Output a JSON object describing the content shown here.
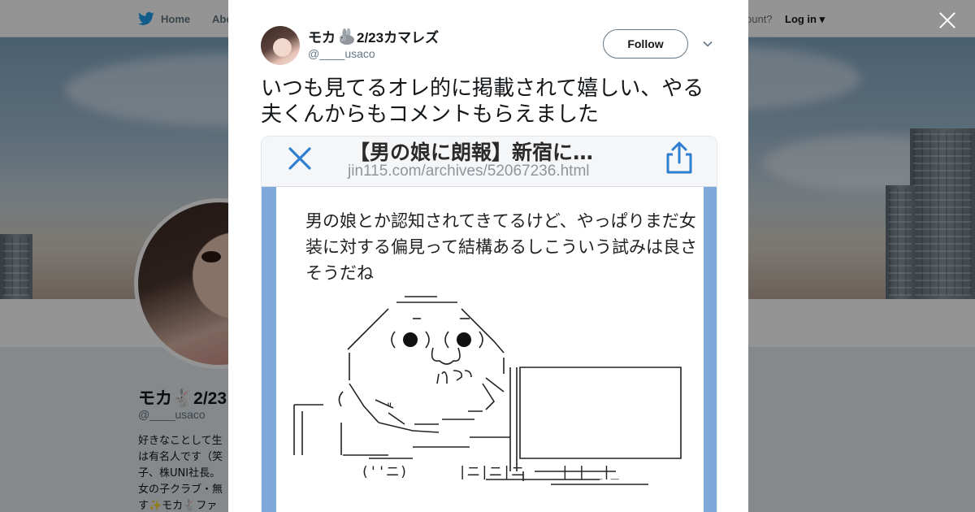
{
  "nav": {
    "home": "Home",
    "about": "Abo",
    "account_text": "ccount?",
    "login": "Log in"
  },
  "profile": {
    "name": "モカ🐇2/23",
    "handle": "@____usaco",
    "bio_lines": [
      "好きなことして生",
      "は有名人です（笑",
      "子、株UNI社長。",
      "女の子クラブ・無",
      "す✨モカ🐇ファ"
    ]
  },
  "tweet": {
    "display_name": "モカ",
    "display_name_suffix": "2/23カマレズ",
    "handle": "@____usaco",
    "follow_label": "Follow",
    "text": "いつも見てるオレ的に掲載されて嬉しい、やる夫くんからもコメントもらえました",
    "image": {
      "title": "【男の娘に朗報】新宿に…",
      "url": "jin115.com/archives/52067236.html",
      "comment": "男の娘とか認知されてきてるけど、やっぱりまだ女装に対する偏見って結構あるしこういう試みは良さそうだね",
      "ascii_quote_mark": "\"",
      "ascii_bottom_left": "(''ニ)",
      "ascii_bottom_mid": "|ニ|ニ|ニ",
      "ascii_bottom_right": "_|_|__|_"
    }
  },
  "colors": {
    "twitter_blue": "#1da1f2",
    "frame_blue": "#7ea9d8",
    "link_gray": "#657786"
  },
  "icons": [
    "twitter-bird-icon",
    "close-icon",
    "rabbit-emoji-icon",
    "chevron-down-icon",
    "image-close-icon",
    "share-icon"
  ]
}
